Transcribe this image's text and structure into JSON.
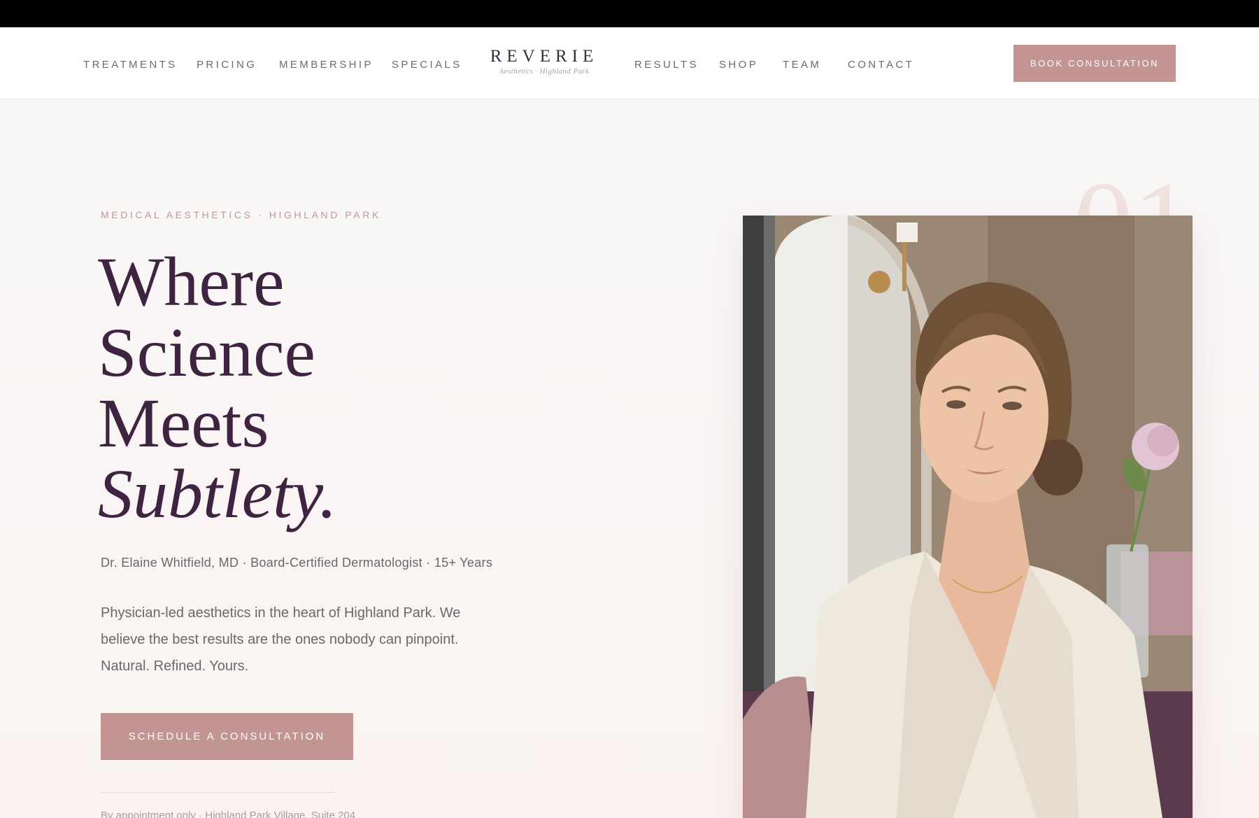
{
  "nav": {
    "left_links": [
      "TREATMENTS",
      "PRICING",
      "MEMBERSHIP",
      "SPECIALS"
    ],
    "right_links": [
      "RESULTS",
      "SHOP",
      "TEAM",
      "CONTACT"
    ],
    "logo_word": "REVERIE",
    "logo_sub": "Aesthetics · Highland Park",
    "cta": "BOOK CONSULTATION"
  },
  "hero": {
    "index_number": "01",
    "eyebrow": "MEDICAL AESTHETICS · HIGHLAND PARK",
    "headline_lines": [
      "Where",
      "Science",
      "Meets",
      "Subtlety."
    ],
    "credentials": "Dr. Elaine Whitfield, MD · Board-Certified Dermatologist · 15+ Years",
    "intro": "Physician-led aesthetics in the heart of Highland Park. We believe the best results are the ones nobody can pinpoint. Natural. Refined. Yours.",
    "cta": "SCHEDULE A CONSULTATION",
    "address": "By appointment only · Highland Park Village, Suite 204"
  },
  "colors": {
    "accent": "#c29492",
    "headline": "#3e2440",
    "eyebrow": "#c09896"
  }
}
